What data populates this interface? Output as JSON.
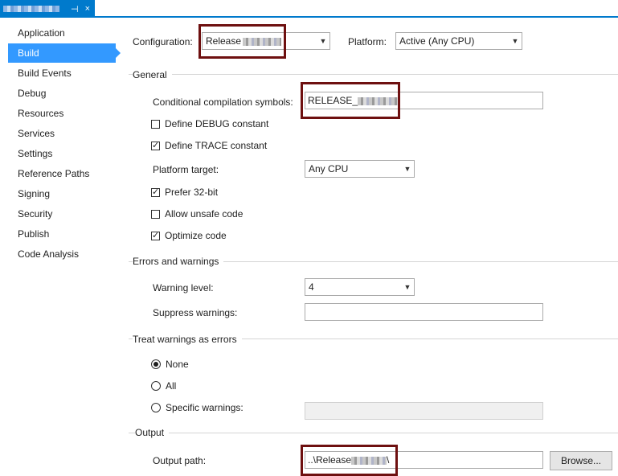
{
  "tab": {
    "pin_icon": "pin-icon",
    "close_glyph": "×"
  },
  "sidebar": {
    "items": [
      {
        "label": "Application"
      },
      {
        "label": "Build",
        "active": true
      },
      {
        "label": "Build Events"
      },
      {
        "label": "Debug"
      },
      {
        "label": "Resources"
      },
      {
        "label": "Services"
      },
      {
        "label": "Settings"
      },
      {
        "label": "Reference Paths"
      },
      {
        "label": "Signing"
      },
      {
        "label": "Security"
      },
      {
        "label": "Publish"
      },
      {
        "label": "Code Analysis"
      }
    ]
  },
  "header": {
    "configuration_label": "Configuration:",
    "configuration_value": "Release",
    "platform_label": "Platform:",
    "platform_value": "Active (Any CPU)"
  },
  "general": {
    "title": "General",
    "symbols_label": "Conditional compilation symbols:",
    "symbols_value": "RELEASE_",
    "define_debug_label": "Define DEBUG constant",
    "define_debug_checked": false,
    "define_trace_label": "Define TRACE constant",
    "define_trace_checked": true,
    "platform_target_label": "Platform target:",
    "platform_target_value": "Any CPU",
    "prefer32_label": "Prefer 32-bit",
    "prefer32_checked": true,
    "unsafe_label": "Allow unsafe code",
    "unsafe_checked": false,
    "optimize_label": "Optimize code",
    "optimize_checked": true
  },
  "errors": {
    "title": "Errors and warnings",
    "warning_level_label": "Warning level:",
    "warning_level_value": "4",
    "suppress_label": "Suppress warnings:",
    "suppress_value": ""
  },
  "treat": {
    "title": "Treat warnings as errors",
    "none_label": "None",
    "all_label": "All",
    "specific_label": "Specific warnings:",
    "selected": "none"
  },
  "output": {
    "title": "Output",
    "path_label": "Output path:",
    "path_prefix": "..\\Release",
    "path_suffix": "\\",
    "browse_label": "Browse..."
  },
  "colors": {
    "accent": "#007acc",
    "selection": "#3399ff",
    "highlight_box": "#6e1010"
  }
}
